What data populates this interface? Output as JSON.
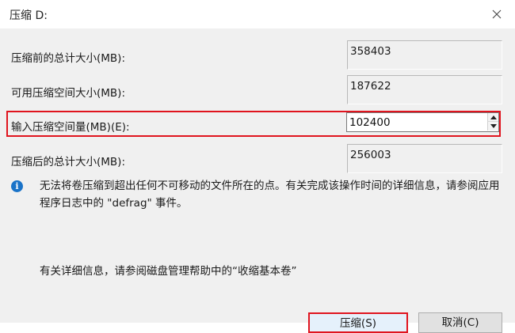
{
  "window": {
    "title": "压缩 D:"
  },
  "fields": {
    "total_before": {
      "label": "压缩前的总计大小(MB):",
      "value": "358403"
    },
    "available": {
      "label": "可用压缩空间大小(MB):",
      "value": "187622"
    },
    "shrink_amount": {
      "label": "输入压缩空间量(MB)(E):",
      "value": "102400"
    },
    "total_after": {
      "label": "压缩后的总计大小(MB):",
      "value": "256003"
    }
  },
  "info": {
    "message": "无法将卷压缩到超出任何不可移动的文件所在的点。有关完成该操作时间的详细信息，请参阅应用程序日志中的 \"defrag\" 事件。",
    "help": "有关详细信息，请参阅磁盘管理帮助中的“收缩基本卷”"
  },
  "buttons": {
    "shrink": "压缩(S)",
    "cancel": "取消(C)"
  },
  "colors": {
    "highlight": "#e0141e",
    "info_icon": "#1a73c8"
  }
}
